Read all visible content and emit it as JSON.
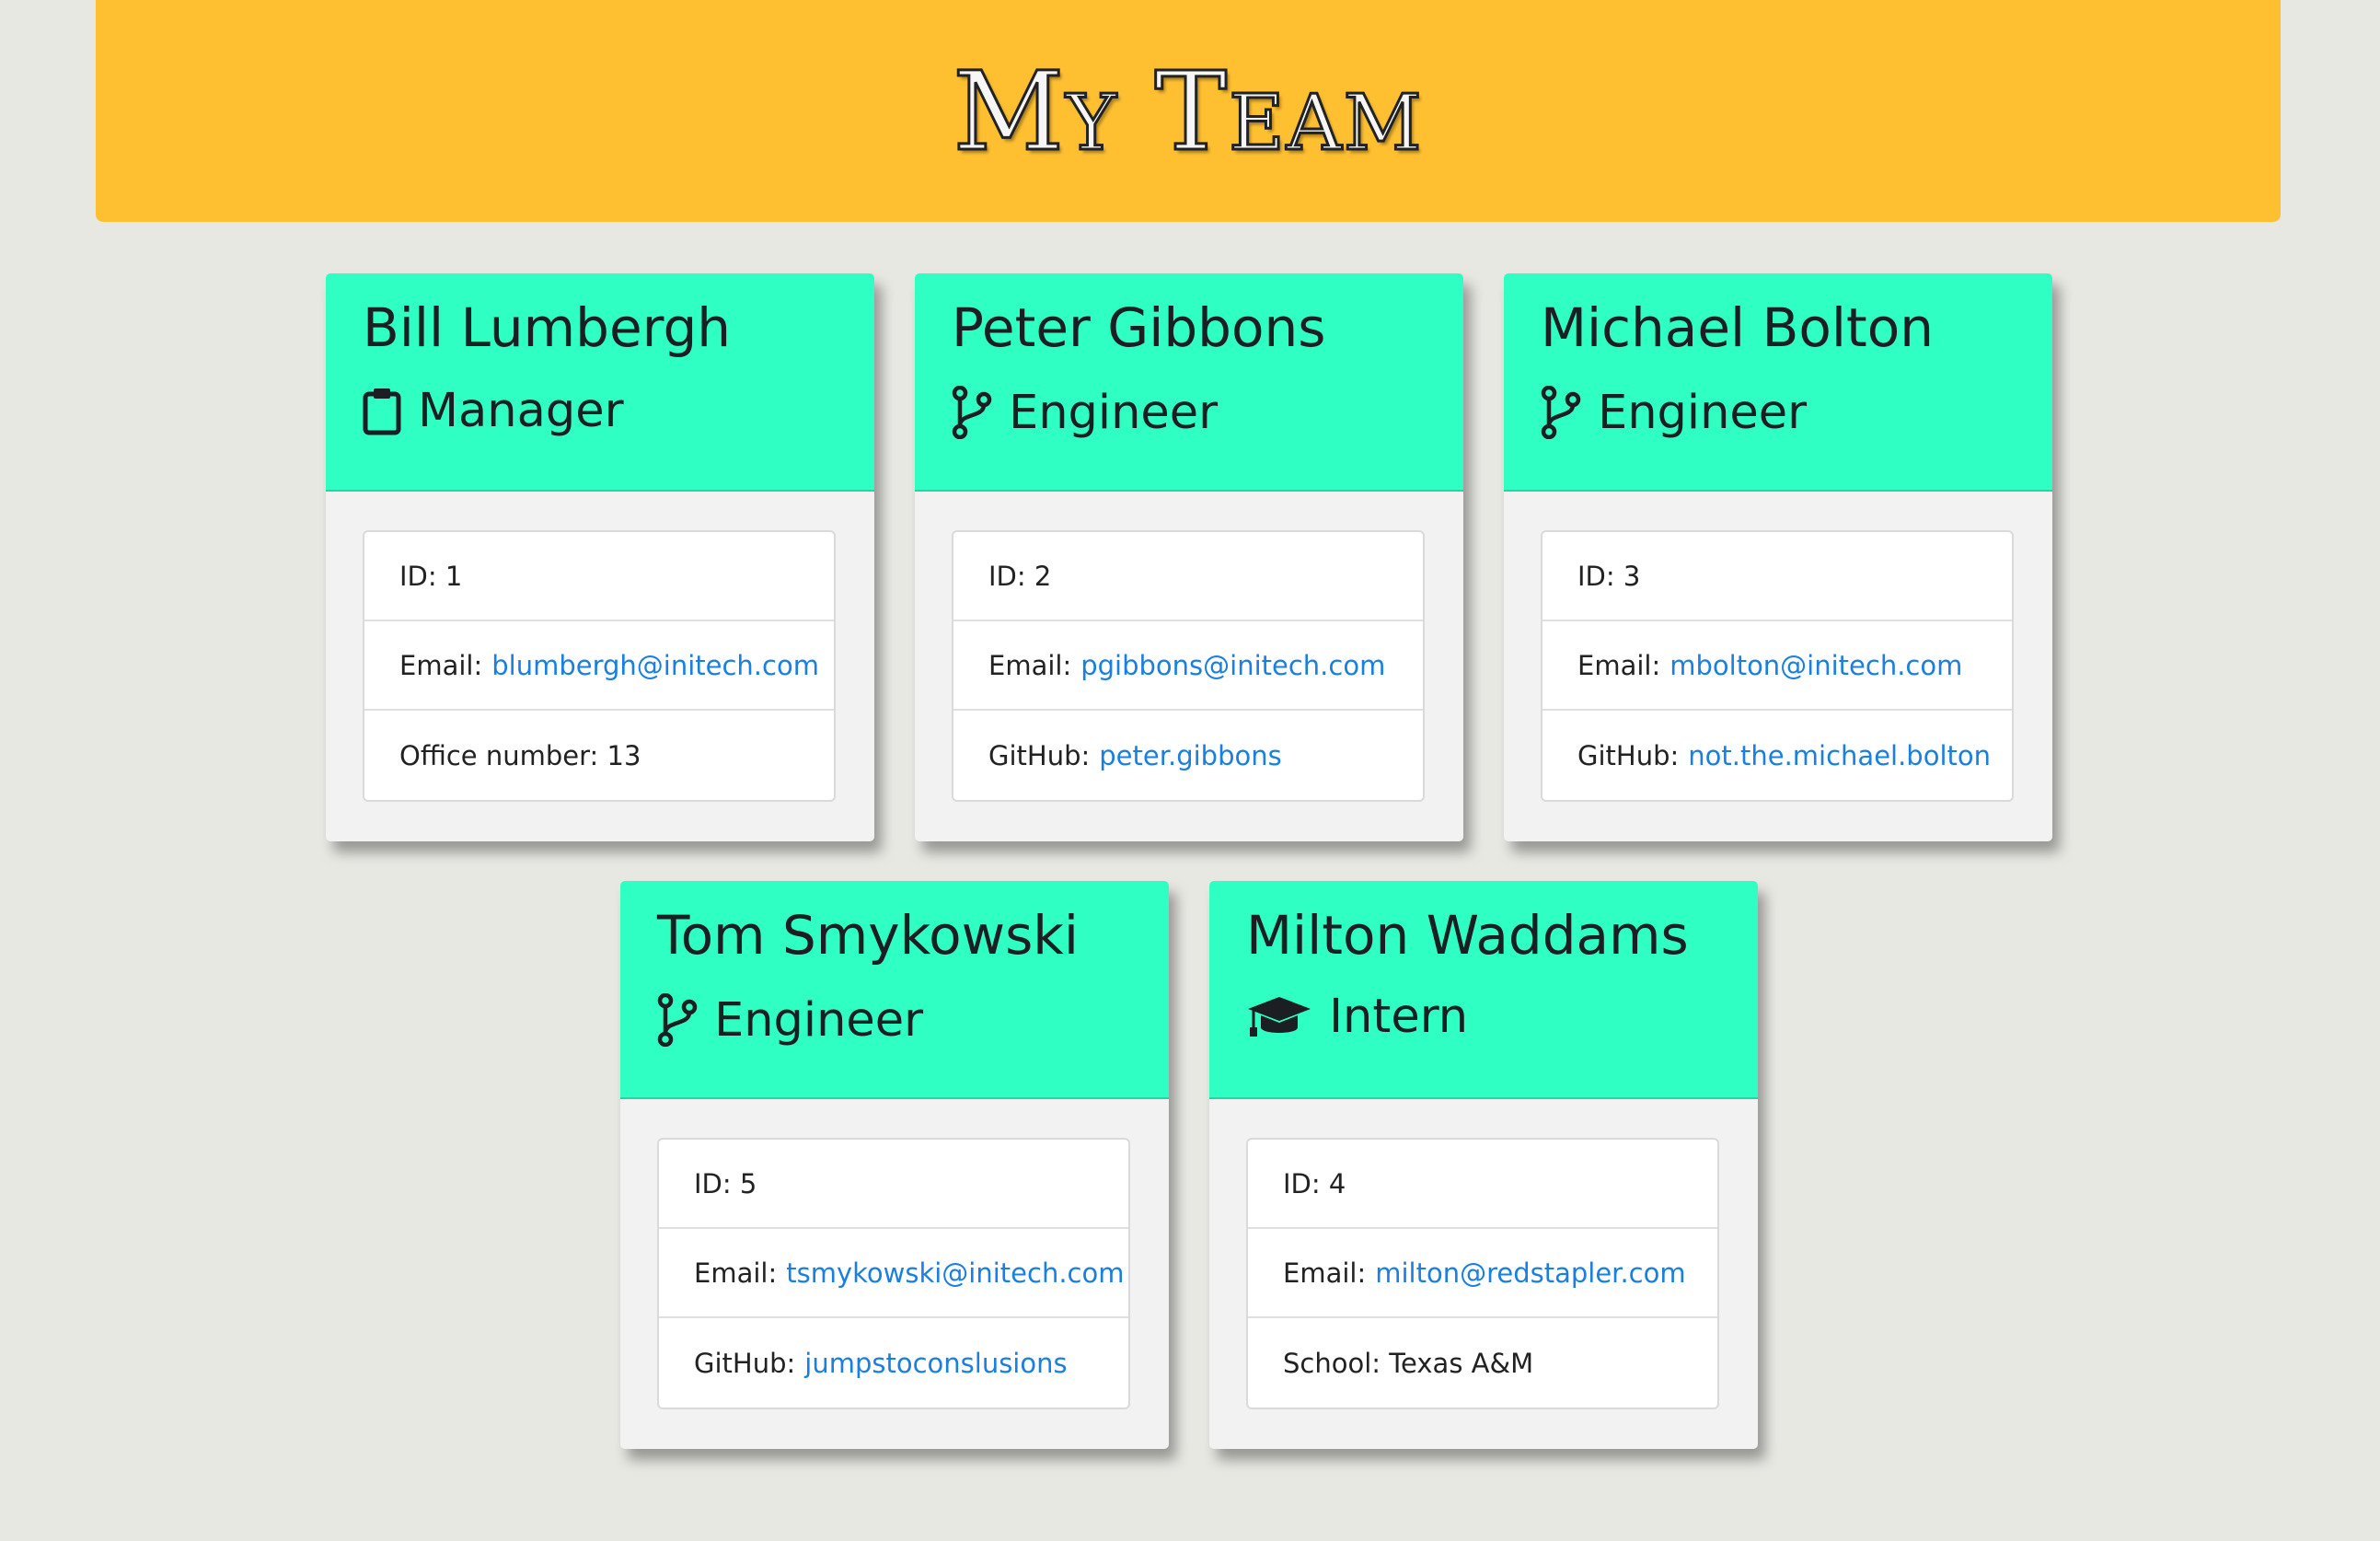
{
  "page": {
    "title": "My Team"
  },
  "colors": {
    "banner": "#fec031",
    "card_header": "#2fffc2",
    "link": "#1b7fe0",
    "background": "#e8e8e3"
  },
  "employees": [
    {
      "name": "Bill Lumbergh",
      "role": "Manager",
      "icon": "clipboard-icon",
      "id_label": "ID:",
      "id": "1",
      "email_label": "Email:",
      "email": "blumbergh@initech.com",
      "extra_label": "Office number:",
      "extra_value": "13"
    },
    {
      "name": "Peter Gibbons",
      "role": "Engineer",
      "icon": "code-branch-icon",
      "id_label": "ID:",
      "id": "2",
      "email_label": "Email:",
      "email": "pgibbons@initech.com",
      "extra_label": "GitHub:",
      "extra_value": "peter.gibbons"
    },
    {
      "name": "Michael Bolton",
      "role": "Engineer",
      "icon": "code-branch-icon",
      "id_label": "ID:",
      "id": "3",
      "email_label": "Email:",
      "email": "mbolton@initech.com",
      "extra_label": "GitHub:",
      "extra_value": "not.the.michael.bolton"
    },
    {
      "name": "Tom Smykowski",
      "role": "Engineer",
      "icon": "code-branch-icon",
      "id_label": "ID:",
      "id": "5",
      "email_label": "Email:",
      "email": "tsmykowski@initech.com",
      "extra_label": "GitHub:",
      "extra_value": "jumpstoconslusions"
    },
    {
      "name": "Milton Waddams",
      "role": "Intern",
      "icon": "graduation-cap-icon",
      "id_label": "ID:",
      "id": "4",
      "email_label": "Email:",
      "email": "milton@redstapler.com",
      "extra_label": "School:",
      "extra_value": "Texas A&M"
    }
  ]
}
